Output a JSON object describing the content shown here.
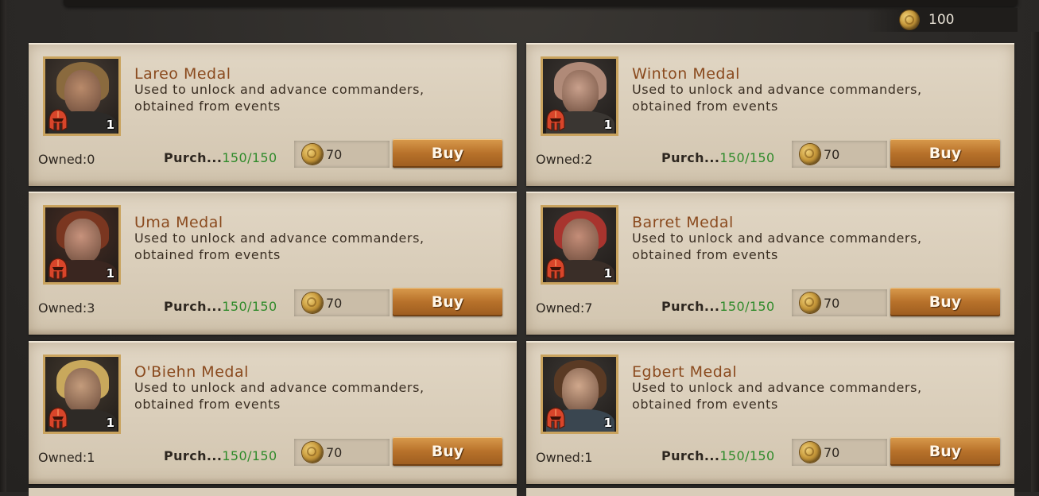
{
  "currency": {
    "icon": "gold-coin-icon",
    "amount": "100"
  },
  "labels": {
    "owned_prefix": "Owned:",
    "purchase_prefix": "Purch...",
    "buy": "Buy"
  },
  "items": [
    {
      "title": "Lareo Medal",
      "description": "Used to unlock and advance commanders, obtained from events",
      "owned": "Owned:0",
      "purchase_label": "Purch...",
      "purchase_limit": "150/150",
      "price": "70",
      "count": "1",
      "buy_label": "Buy",
      "portrait": {
        "skin": "#b98a6a",
        "hair": "#8a6a3e",
        "body": "#2c2a28",
        "bg": "#4a3f36"
      }
    },
    {
      "title": "Winton Medal",
      "description": "Used to unlock and advance commanders, obtained from events",
      "owned": "Owned:2",
      "purchase_label": "Purch...",
      "purchase_limit": "150/150",
      "price": "70",
      "count": "1",
      "buy_label": "Buy",
      "portrait": {
        "skin": "#c9a08c",
        "hair": "#b08a78",
        "body": "#3a3632",
        "bg": "#3d3834"
      }
    },
    {
      "title": "Uma Medal",
      "description": "Used to unlock and advance commanders, obtained from events",
      "owned": "Owned:3",
      "purchase_label": "Purch...",
      "purchase_limit": "150/150",
      "price": "70",
      "count": "1",
      "buy_label": "Buy",
      "portrait": {
        "skin": "#c7927c",
        "hair": "#7a3620",
        "body": "#3a2620",
        "bg": "#4a2e24"
      }
    },
    {
      "title": "Barret Medal",
      "description": "Used to unlock and advance commanders, obtained from events",
      "owned": "Owned:7",
      "purchase_label": "Purch...",
      "purchase_limit": "150/150",
      "price": "70",
      "count": "1",
      "buy_label": "Buy",
      "portrait": {
        "skin": "#c48d78",
        "hair": "#a8342e",
        "body": "#3a2e28",
        "bg": "#3a3430"
      }
    },
    {
      "title": "O'Biehn Medal",
      "description": "Used to unlock and advance commanders, obtained from events",
      "owned": "Owned:1",
      "purchase_label": "Purch...",
      "purchase_limit": "150/150",
      "price": "70",
      "count": "1",
      "buy_label": "Buy",
      "portrait": {
        "skin": "#c49c7c",
        "hair": "#c8a85c",
        "body": "#2e2a26",
        "bg": "#463c30"
      }
    },
    {
      "title": "Egbert Medal",
      "description": "Used to unlock and advance commanders, obtained from events",
      "owned": "Owned:1",
      "purchase_label": "Purch...",
      "purchase_limit": "150/150",
      "price": "70",
      "count": "1",
      "buy_label": "Buy",
      "portrait": {
        "skin": "#d0a88c",
        "hair": "#5a3a24",
        "body": "#3a4650",
        "bg": "#3e3a36"
      }
    }
  ],
  "colors": {
    "title": "#8a4a1e",
    "purchase_value": "#2f8a2a",
    "card_bg": "#d9cdb9",
    "button": "#b7712a",
    "frame": "#c9a35e"
  }
}
